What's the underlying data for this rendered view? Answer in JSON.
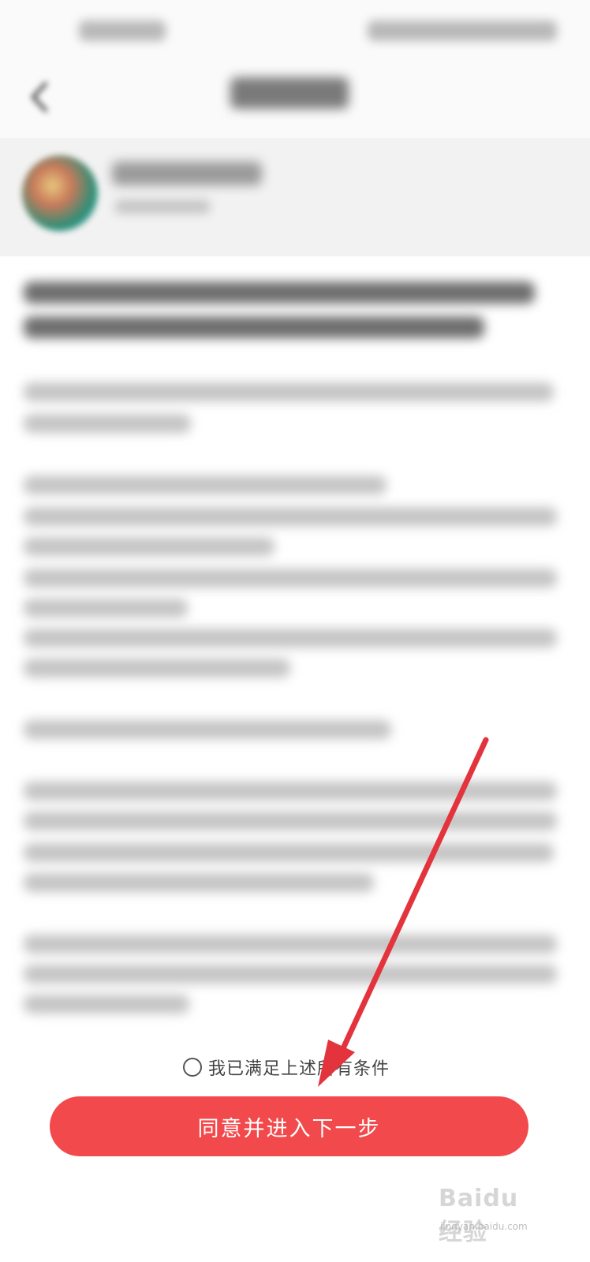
{
  "agreement": {
    "checkbox_label": "我已满足上述所有条件",
    "confirm_button": "同意并进入下一步"
  },
  "watermark": {
    "logo": "Baidu 经验",
    "url": "jingyan.baidu.com"
  },
  "colors": {
    "primary": "#f24a4c",
    "annotation_arrow": "#e3343e"
  },
  "icons": {
    "back": "back-arrow-icon",
    "checkbox": "radio-circle-icon"
  }
}
